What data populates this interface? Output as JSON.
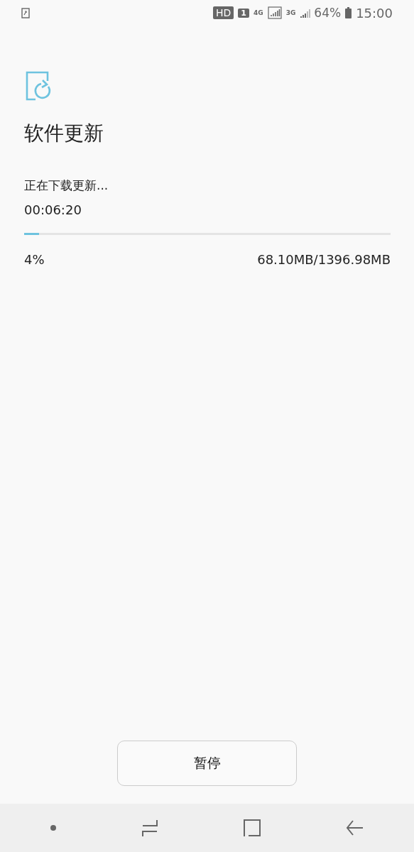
{
  "status_bar": {
    "network_badge": "HD",
    "sim_badge": "1",
    "network_1": "4G",
    "network_2": "3G",
    "battery": "64%",
    "time": "15:00"
  },
  "header": {
    "title": "软件更新"
  },
  "download": {
    "status": "正在下载更新...",
    "elapsed": "00:06:20",
    "level": 0.04,
    "percent": "4%",
    "size": "68.10MB/1396.98MB"
  },
  "button": {
    "label": "暂停"
  }
}
